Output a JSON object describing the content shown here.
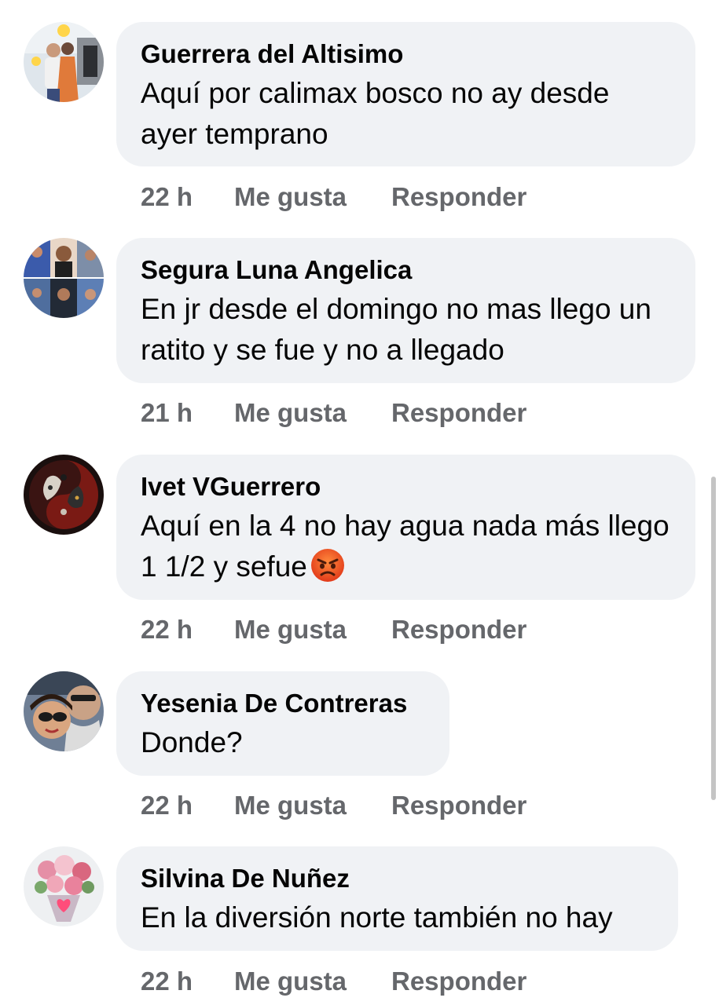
{
  "comments": [
    {
      "author": "Guerrera del Altisimo",
      "text": "Aquí por calimax bosco no ay desde ayer  temprano",
      "time": "22 h",
      "like_label": "Me gusta",
      "reply_label": "Responder",
      "avatar_icon": "couple-photo-avatar"
    },
    {
      "author": "Segura Luna Angelica",
      "text": "En jr desde el domingo no mas llego un ratito y se fue y no a llegado",
      "time": "21 h",
      "like_label": "Me gusta",
      "reply_label": "Responder",
      "avatar_icon": "collage-avatar"
    },
    {
      "author": "Ivet VGuerrero",
      "text": "Aquí en la 4 no hay agua nada más llego 1 1/2 y sefue",
      "emoji": "angry-face-icon",
      "time": "22 h",
      "like_label": "Me gusta",
      "reply_label": "Responder",
      "avatar_icon": "lion-yin-yang-avatar"
    },
    {
      "author": "Yesenia De Contreras",
      "text": "Donde?",
      "time": "22 h",
      "like_label": "Me gusta",
      "reply_label": "Responder",
      "avatar_icon": "selfie-couple-avatar"
    },
    {
      "author": "Silvina De Nuñez",
      "text": "En la diversión norte también no hay",
      "time": "22 h",
      "like_label": "Me gusta",
      "reply_label": "Responder",
      "avatar_icon": "flower-bouquet-avatar"
    }
  ],
  "colors": {
    "bubble_bg": "#f0f2f5",
    "author_text": "#050505",
    "meta_text": "#65676b"
  }
}
